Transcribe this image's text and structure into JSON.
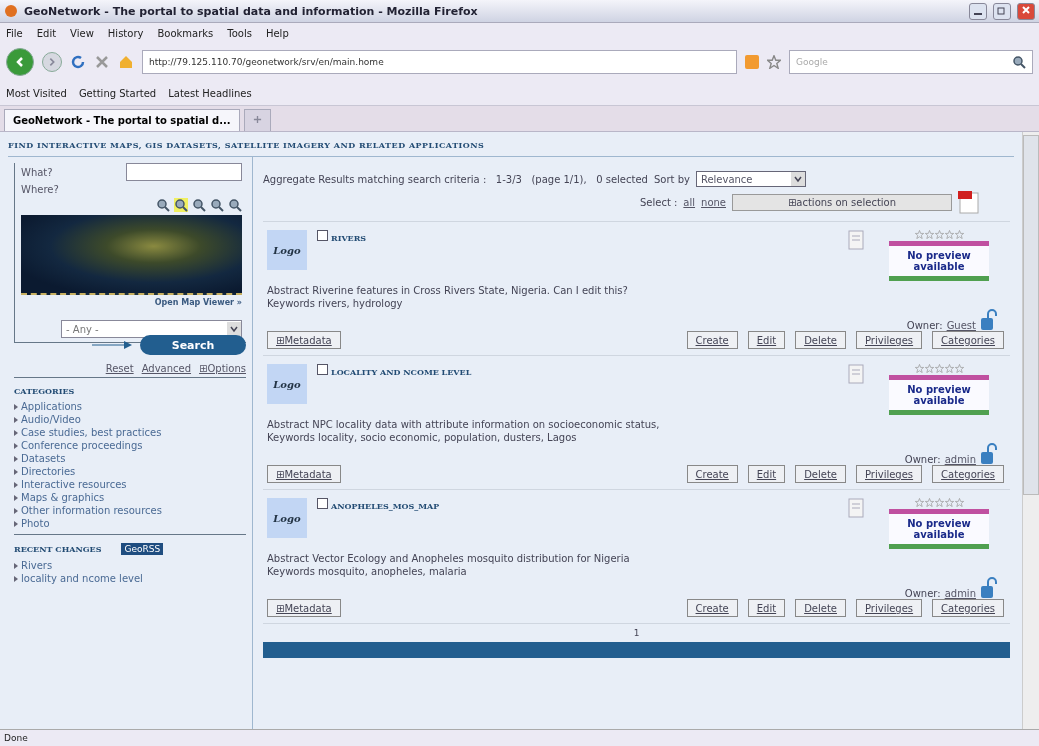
{
  "window": {
    "title": "GeoNetwork - The portal to spatial data and information - Mozilla Firefox"
  },
  "menu": [
    "File",
    "Edit",
    "View",
    "History",
    "Bookmarks",
    "Tools",
    "Help"
  ],
  "address": {
    "value": "http://79.125.110.70/geonetwork/srv/en/main.home"
  },
  "search_engine": {
    "placeholder": "Google"
  },
  "bookmarks": [
    "Most Visited",
    "Getting Started",
    "Latest Headlines"
  ],
  "tabs": [
    {
      "label": "GeoNetwork - The portal to spatial d...",
      "selected": true
    }
  ],
  "page_header": "FIND INTERACTIVE MAPS, GIS DATASETS, SATELLITE IMAGERY AND RELATED APPLICATIONS",
  "sidebar": {
    "what_label": "What?",
    "where_label": "Where?",
    "open_map": "Open Map Viewer »",
    "region": "- Any -",
    "search": "Search",
    "links": [
      "Reset",
      "Advanced",
      "⊞Options"
    ],
    "categories_title": "CATEGORIES",
    "categories": [
      "Applications",
      "Audio/Video",
      "Case studies, best practices",
      "Conference proceedings",
      "Datasets",
      "Directories",
      "Interactive resources",
      "Maps & graphics",
      "Other information resources",
      "Photo"
    ],
    "recent_title": "RECENT CHANGES",
    "georss": "GeoRSS",
    "recent": [
      "Rivers",
      "locality and ncome level"
    ]
  },
  "results": {
    "summary": "Aggregate Results matching search criteria :   1-3/3   (page 1/1),   0 selected",
    "sort_label": "Sort by",
    "sort_value": "Relevance",
    "select_label": "Select :",
    "select_all": "all",
    "select_none": "none",
    "actions": "⊞actions on selection",
    "records": [
      {
        "logo": "Logo",
        "title": "RIVERS",
        "checked": false,
        "stars": 0,
        "abstract_label": "Abstract",
        "abstract": "Riverine features in Cross Rivers State, Nigeria. Can I edit this?",
        "keywords_label": "Keywords",
        "keywords": "rivers, hydrology",
        "preview": "No preview available",
        "owner_label": "Owner:",
        "owner": "Guest",
        "metadata": "⊞Metadata",
        "buttons": [
          "Create",
          "Edit",
          "Delete",
          "Privileges",
          "Categories"
        ]
      },
      {
        "logo": "Logo",
        "title": "LOCALITY AND NCOME LEVEL",
        "checked": false,
        "stars": 0,
        "abstract_label": "Abstract",
        "abstract": "NPC locality data with attribute information on socioeconomic status,",
        "keywords_label": "Keywords",
        "keywords": "locality, socio economic, population, dusters, Lagos",
        "preview": "No preview available",
        "owner_label": "Owner:",
        "owner": "admin",
        "metadata": "⊞Metadata",
        "buttons": [
          "Create",
          "Edit",
          "Delete",
          "Privileges",
          "Categories"
        ]
      },
      {
        "logo": "Logo",
        "title": "ANOPHELES_MOS_MAP",
        "checked": false,
        "stars": 0,
        "abstract_label": "Abstract",
        "abstract": "Vector Ecology and Anopheles mosquito distribution for Nigeria",
        "keywords_label": "Keywords",
        "keywords": "mosquito, anopheles, malaria",
        "preview": "No preview available",
        "owner_label": "Owner:",
        "owner": "admin",
        "metadata": "⊞Metadata",
        "buttons": [
          "Create",
          "Edit",
          "Delete",
          "Privileges",
          "Categories"
        ]
      }
    ],
    "pages": "1"
  },
  "status_bar": "Done"
}
